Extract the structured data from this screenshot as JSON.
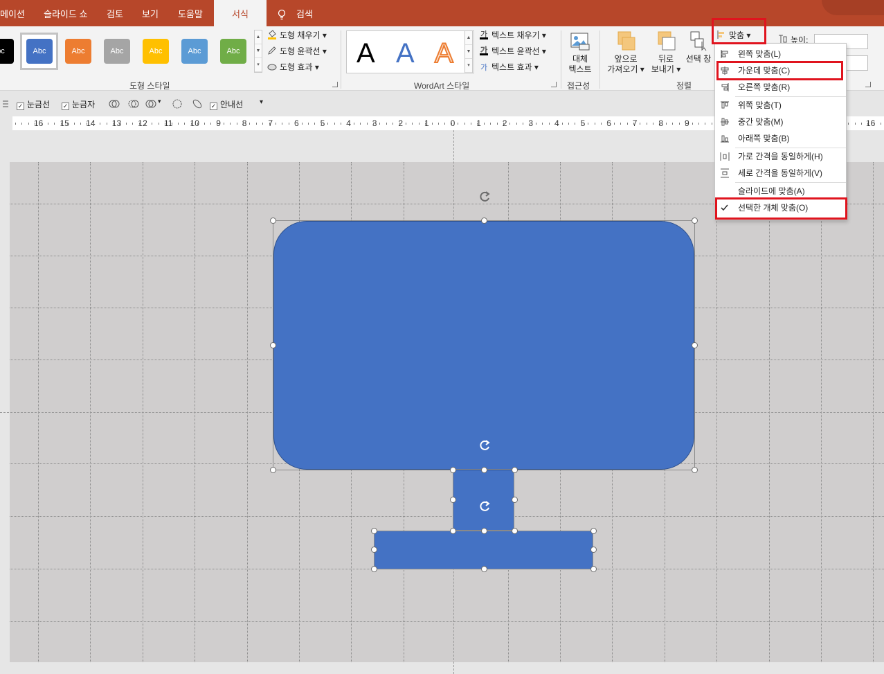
{
  "tabs": [
    {
      "label": "메이션"
    },
    {
      "label": "슬라이드 쇼"
    },
    {
      "label": "검토"
    },
    {
      "label": "보기"
    },
    {
      "label": "도움말"
    },
    {
      "label": "서식"
    },
    {
      "label": "검색"
    }
  ],
  "shape_styles": {
    "group_label": "도형 스타일",
    "items": [
      {
        "label": "bc",
        "color": "#000000"
      },
      {
        "label": "Abc",
        "color": "#4472c4"
      },
      {
        "label": "Abc",
        "color": "#ed7d31"
      },
      {
        "label": "Abc",
        "color": "#a5a5a5"
      },
      {
        "label": "Abc",
        "color": "#ffc000"
      },
      {
        "label": "Abc",
        "color": "#5b9bd5"
      },
      {
        "label": "Abc",
        "color": "#70ad47"
      }
    ],
    "fill": "도형 채우기",
    "outline": "도형 윤곽선",
    "effects": "도형 효과"
  },
  "wordart": {
    "group_label": "WordArt 스타일",
    "letters": [
      "A",
      "A",
      "A"
    ],
    "text_fill": "텍스트 채우기",
    "text_outline": "텍스트 윤곽선",
    "text_effects": "텍스트 효과"
  },
  "accessibility": {
    "group_label": "접근성",
    "alt_text_line1": "대체",
    "alt_text_line2": "텍스트"
  },
  "arrange": {
    "group_label": "정렬",
    "bring_forward_line1": "앞으로",
    "bring_forward_line2": "가져오기",
    "send_backward_line1": "뒤로",
    "send_backward_line2": "보내기",
    "selection_pane": "선택 창",
    "align": "맞춤"
  },
  "size": {
    "height_label": "높이:"
  },
  "quick_row": {
    "gridlines": "눈금선",
    "ruler": "눈금자",
    "guides": "안내선"
  },
  "ruler": {
    "labels": [
      "16",
      "15",
      "14",
      "13",
      "12",
      "11",
      "10",
      "9",
      "8",
      "7",
      "6",
      "5",
      "4",
      "3",
      "2",
      "1",
      "0",
      "1",
      "2",
      "3",
      "4",
      "5",
      "6",
      "7",
      "8",
      "9",
      "1",
      "5",
      "16"
    ]
  },
  "align_menu": {
    "items": [
      {
        "label": "왼쪽 맞춤(L)",
        "icon": "align-left-icon"
      },
      {
        "label": "가운데 맞춤(C)",
        "icon": "align-center-icon"
      },
      {
        "label": "오른쪽 맞춤(R)",
        "icon": "align-right-icon"
      },
      {
        "label": "위쪽 맞춤(T)",
        "icon": "align-top-icon"
      },
      {
        "label": "중간 맞춤(M)",
        "icon": "align-middle-icon"
      },
      {
        "label": "아래쪽 맞춤(B)",
        "icon": "align-bottom-icon"
      },
      {
        "label": "가로 간격을 동일하게(H)",
        "icon": "distribute-horizontal-icon"
      },
      {
        "label": "세로 간격을 동일하게(V)",
        "icon": "distribute-vertical-icon"
      },
      {
        "label": "슬라이드에 맞춤(A)",
        "icon": ""
      },
      {
        "label": "선택한 개체 맞춤(O)",
        "icon": "checkmark-icon"
      }
    ],
    "checked_item": "선택한 개체 맞춤(O)"
  },
  "colors": {
    "accent": "#b7472a",
    "shape_fill": "#4472c4",
    "highlight": "#e0141e"
  }
}
